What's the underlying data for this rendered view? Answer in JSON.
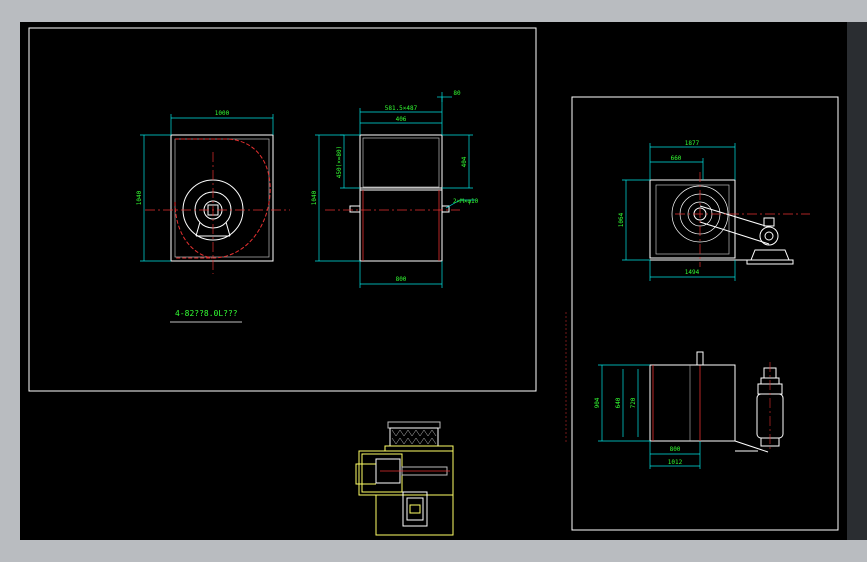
{
  "colors": {
    "frame": "#ffffff",
    "dimension": "#00e5e5",
    "center_line": "#e53030",
    "yellow_line": "#ffff66",
    "label": "#33ff33",
    "gray_line": "#bdbdbd",
    "background": "#000000"
  },
  "view1": {
    "width_dim": "1000",
    "height_dim": "1040"
  },
  "view2": {
    "top_dim": "581.5×487",
    "mid_dim": "406",
    "right_dim": "404",
    "left_dim_inner": "450(×=80)",
    "left_dim_outer": "1040",
    "bottom_dim": "800",
    "side_note": "2×M×φ10",
    "top_small": "80"
  },
  "title_label": "4-82??8.0L???",
  "view3": {
    "top_outer": "1877",
    "top_inner": "660",
    "left_dim": "1064",
    "bottom_dim": "1494"
  },
  "view4": {
    "left_outer": "904",
    "left_inner": "640",
    "left_small": "720",
    "bottom_inner": "800",
    "bottom_outer": "1012"
  }
}
